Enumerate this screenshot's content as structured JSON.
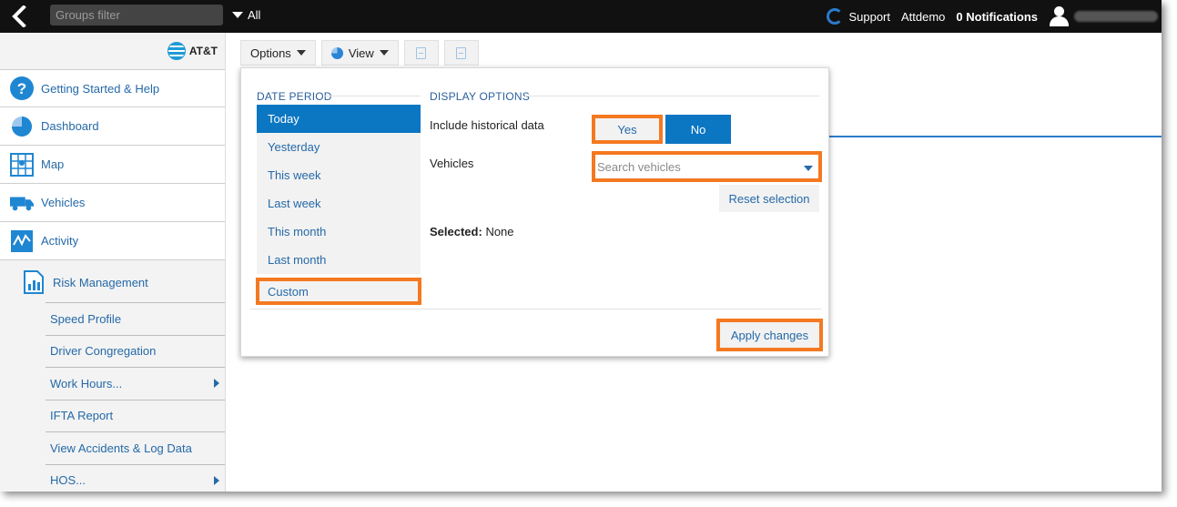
{
  "topbar": {
    "groups_filter_placeholder": "Groups filter",
    "all_label": "All",
    "support_label": "Support",
    "user_name": "Attdemo",
    "notifications_label": "0 Notifications"
  },
  "sidebar": {
    "brand_label": "AT&T",
    "items": [
      {
        "label": "Getting Started & Help",
        "icon": "help-icon"
      },
      {
        "label": "Dashboard",
        "icon": "dashboard-icon"
      },
      {
        "label": "Map",
        "icon": "map-icon"
      },
      {
        "label": "Vehicles",
        "icon": "truck-icon"
      },
      {
        "label": "Activity",
        "icon": "activity-icon"
      }
    ],
    "section": {
      "label": "Risk Management",
      "icon": "report-icon"
    },
    "sub_items": [
      {
        "label": "Speed Profile",
        "has_submenu": false
      },
      {
        "label": "Driver Congregation",
        "has_submenu": false
      },
      {
        "label": "Work Hours...",
        "has_submenu": true
      },
      {
        "label": "IFTA Report",
        "has_submenu": false
      },
      {
        "label": "View Accidents & Log Data",
        "has_submenu": false
      },
      {
        "label": "HOS...",
        "has_submenu": true
      }
    ]
  },
  "toolbar": {
    "options_label": "Options",
    "view_label": "View"
  },
  "panel": {
    "date_period_title": "DATE PERIOD",
    "display_options_title": "DISPLAY OPTIONS",
    "periods": [
      "Today",
      "Yesterday",
      "This week",
      "Last week",
      "This month",
      "Last month"
    ],
    "custom_label": "Custom",
    "active_period": "Today",
    "historical_label": "Include historical data",
    "yes_label": "Yes",
    "no_label": "No",
    "vehicles_label": "Vehicles",
    "search_placeholder": "Search vehicles",
    "reset_label": "Reset selection",
    "selected_prefix": "Selected:",
    "selected_value": "None",
    "apply_label": "Apply changes"
  },
  "colors": {
    "accent_blue": "#0b76c2",
    "link_blue": "#2569a8",
    "highlight_orange": "#f47920",
    "topbar_bg": "#111111"
  }
}
